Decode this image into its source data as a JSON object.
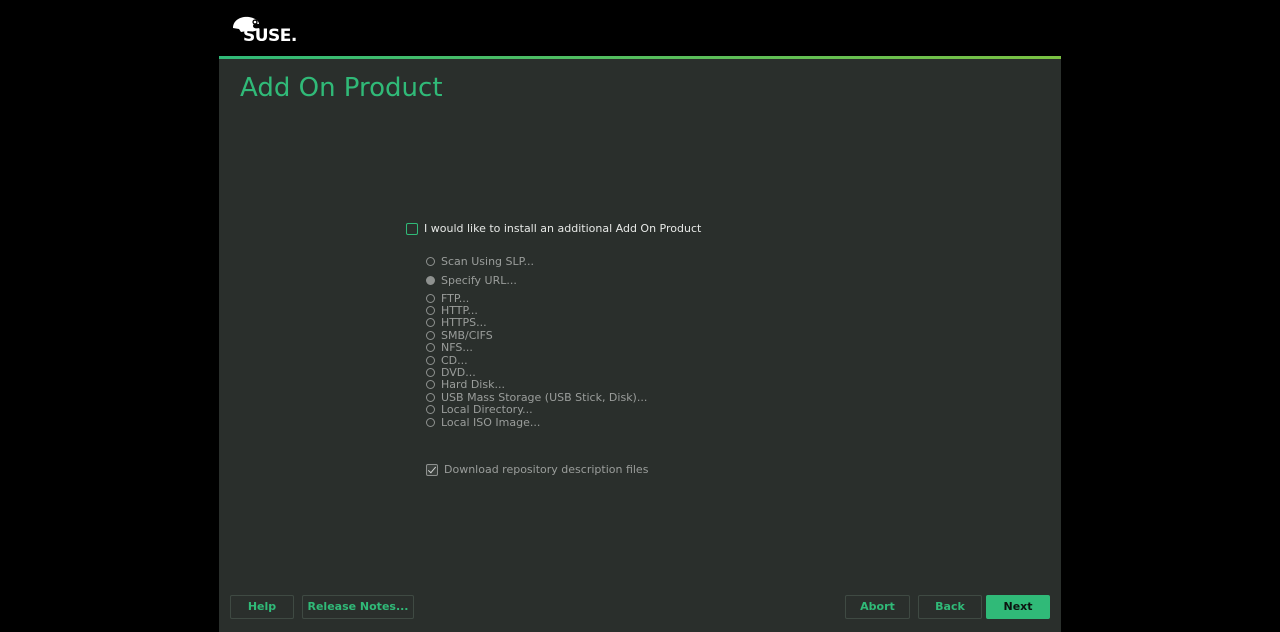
{
  "header": {
    "brand": "SUSE."
  },
  "page": {
    "title": "Add On Product"
  },
  "addon": {
    "main_checkbox_label": "I would like to install an additional Add On Product",
    "main_checked": false,
    "scan_slp": "Scan Using SLP...",
    "specify_url": "Specify URL...",
    "sources": [
      "FTP...",
      "HTTP...",
      "HTTPS...",
      "SMB/CIFS",
      "NFS...",
      "CD...",
      "DVD...",
      "Hard Disk...",
      "USB Mass Storage (USB Stick, Disk)...",
      "Local Directory...",
      "Local ISO Image..."
    ],
    "download_label": "Download repository description files",
    "download_checked": true
  },
  "buttons": {
    "help": "Help",
    "release_notes": "Release Notes...",
    "abort": "Abort",
    "back": "Back",
    "next": "Next"
  },
  "colors": {
    "accent": "#30ba78",
    "panel_bg": "#2a2f2c",
    "background": "#000000"
  }
}
